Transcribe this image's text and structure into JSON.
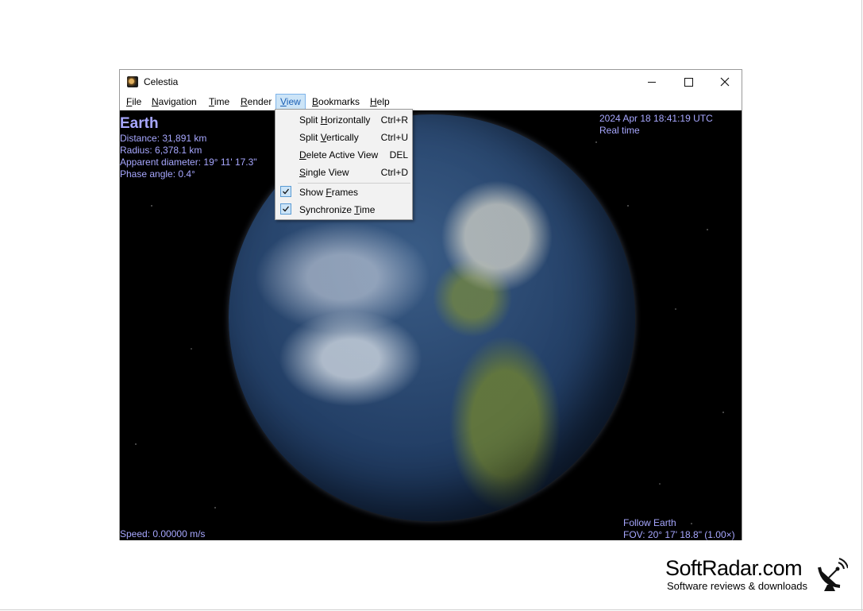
{
  "window": {
    "title": "Celestia",
    "controls": {
      "minimize": "minimize",
      "maximize": "maximize",
      "close": "close"
    }
  },
  "menubar": [
    {
      "label": "File",
      "accel": "F",
      "rest": "ile"
    },
    {
      "label": "Navigation",
      "accel": "N",
      "rest": "avigation"
    },
    {
      "label": "Time",
      "accel": "T",
      "rest": "ime"
    },
    {
      "label": "Render",
      "accel": "R",
      "rest": "ender"
    },
    {
      "label": "View",
      "accel": "V",
      "rest": "iew"
    },
    {
      "label": "Bookmarks",
      "accel": "B",
      "rest": "ookmarks"
    },
    {
      "label": "Help",
      "accel": "H",
      "rest": "elp"
    }
  ],
  "view_menu": {
    "items": [
      {
        "pre": "Split ",
        "accel": "H",
        "post": "orizontally",
        "shortcut": "Ctrl+R"
      },
      {
        "pre": "Split ",
        "accel": "V",
        "post": "ertically",
        "shortcut": "Ctrl+U"
      },
      {
        "pre": "",
        "accel": "D",
        "post": "elete Active View",
        "shortcut": "DEL"
      },
      {
        "pre": "",
        "accel": "S",
        "post": "ingle View",
        "shortcut": "Ctrl+D"
      },
      {
        "pre": "Show ",
        "accel": "F",
        "post": "rames",
        "shortcut": "",
        "checked": true
      },
      {
        "pre": "Synchronize ",
        "accel": "T",
        "post": "ime",
        "shortcut": "",
        "checked": true
      }
    ]
  },
  "hud": {
    "object_name": "Earth",
    "distance": "Distance: 31,891 km",
    "radius": "Radius: 6,378.1 km",
    "apparent_diameter": "Apparent diameter: 19° 11' 17.3\"",
    "phase_angle": "Phase angle: 0.4°",
    "datetime": "2024 Apr 18 18:41:19 UTC",
    "time_mode": "Real time",
    "speed": "Speed: 0.00000 m/s",
    "follow": "Follow Earth",
    "fov": "FOV: 20° 17' 18.8\" (1.00×)"
  },
  "brand": {
    "name": "SoftRadar.com",
    "tagline": "Software reviews & downloads"
  },
  "colors": {
    "hud_text": "#a7a7ff",
    "menu_highlight": "#cce4f7"
  }
}
